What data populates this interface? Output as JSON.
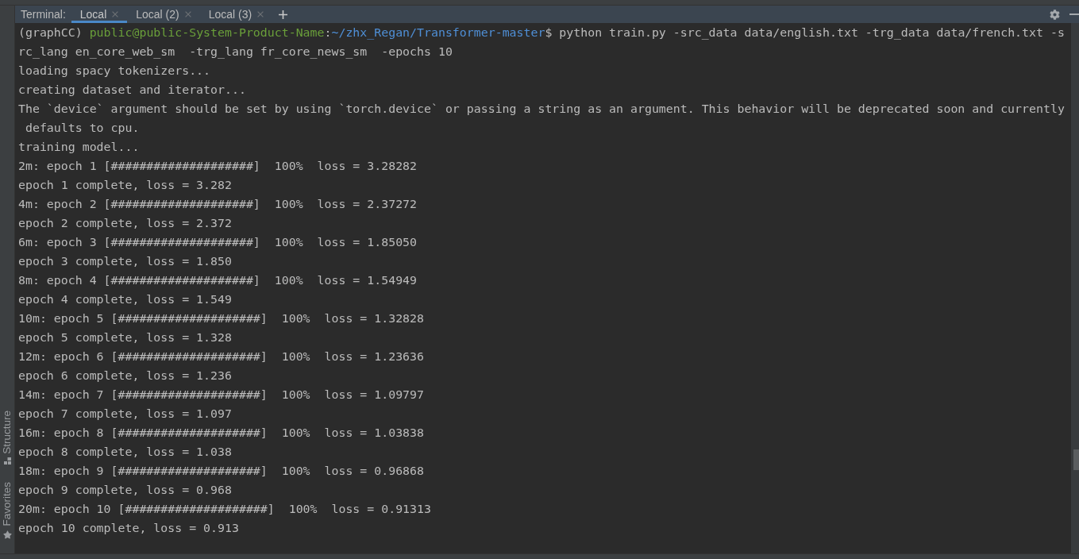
{
  "terminal": {
    "label": "Terminal:",
    "tabs": [
      {
        "label": "Local",
        "selected": true
      },
      {
        "label": "Local (2)",
        "selected": false
      },
      {
        "label": "Local (3)",
        "selected": false
      }
    ]
  },
  "lines": [
    {
      "kind": "prompt",
      "env": "(graphCC) ",
      "user_host": "public@public-System-Product-Name",
      "separator": ":",
      "path": "~/zhx_Regan/Transformer-master",
      "command": "$ python train.py -src_data data/english.txt -trg_data data/french.txt -s"
    },
    {
      "kind": "output",
      "text": "rc_lang en_core_web_sm  -trg_lang fr_core_news_sm  -epochs 10"
    },
    {
      "kind": "output",
      "text": "loading spacy tokenizers..."
    },
    {
      "kind": "output",
      "text": "creating dataset and iterator..."
    },
    {
      "kind": "output",
      "text": "The `device` argument should be set by using `torch.device` or passing a string as an argument. This behavior will be deprecated soon and currently"
    },
    {
      "kind": "output",
      "text": " defaults to cpu."
    },
    {
      "kind": "output",
      "text": "training model..."
    },
    {
      "kind": "output",
      "text": "2m: epoch 1 [####################]  100%  loss = 3.28282"
    },
    {
      "kind": "output",
      "text": "epoch 1 complete, loss = 3.282"
    },
    {
      "kind": "output",
      "text": "4m: epoch 2 [####################]  100%  loss = 2.37272"
    },
    {
      "kind": "output",
      "text": "epoch 2 complete, loss = 2.372"
    },
    {
      "kind": "output",
      "text": "6m: epoch 3 [####################]  100%  loss = 1.85050"
    },
    {
      "kind": "output",
      "text": "epoch 3 complete, loss = 1.850"
    },
    {
      "kind": "output",
      "text": "8m: epoch 4 [####################]  100%  loss = 1.54949"
    },
    {
      "kind": "output",
      "text": "epoch 4 complete, loss = 1.549"
    },
    {
      "kind": "output",
      "text": "10m: epoch 5 [####################]  100%  loss = 1.32828"
    },
    {
      "kind": "output",
      "text": "epoch 5 complete, loss = 1.328"
    },
    {
      "kind": "output",
      "text": "12m: epoch 6 [####################]  100%  loss = 1.23636"
    },
    {
      "kind": "output",
      "text": "epoch 6 complete, loss = 1.236"
    },
    {
      "kind": "output",
      "text": "14m: epoch 7 [####################]  100%  loss = 1.09797"
    },
    {
      "kind": "output",
      "text": "epoch 7 complete, loss = 1.097"
    },
    {
      "kind": "output",
      "text": "16m: epoch 8 [####################]  100%  loss = 1.03838"
    },
    {
      "kind": "output",
      "text": "epoch 8 complete, loss = 1.038"
    },
    {
      "kind": "output",
      "text": "18m: epoch 9 [####################]  100%  loss = 0.96868"
    },
    {
      "kind": "output",
      "text": "epoch 9 complete, loss = 0.968"
    },
    {
      "kind": "output",
      "text": "20m: epoch 10 [####################]  100%  loss = 0.91313"
    },
    {
      "kind": "output",
      "text": "epoch 10 complete, loss = 0.913"
    }
  ],
  "side_tabs": [
    {
      "label": "Structure"
    },
    {
      "label": "Favorites"
    }
  ]
}
